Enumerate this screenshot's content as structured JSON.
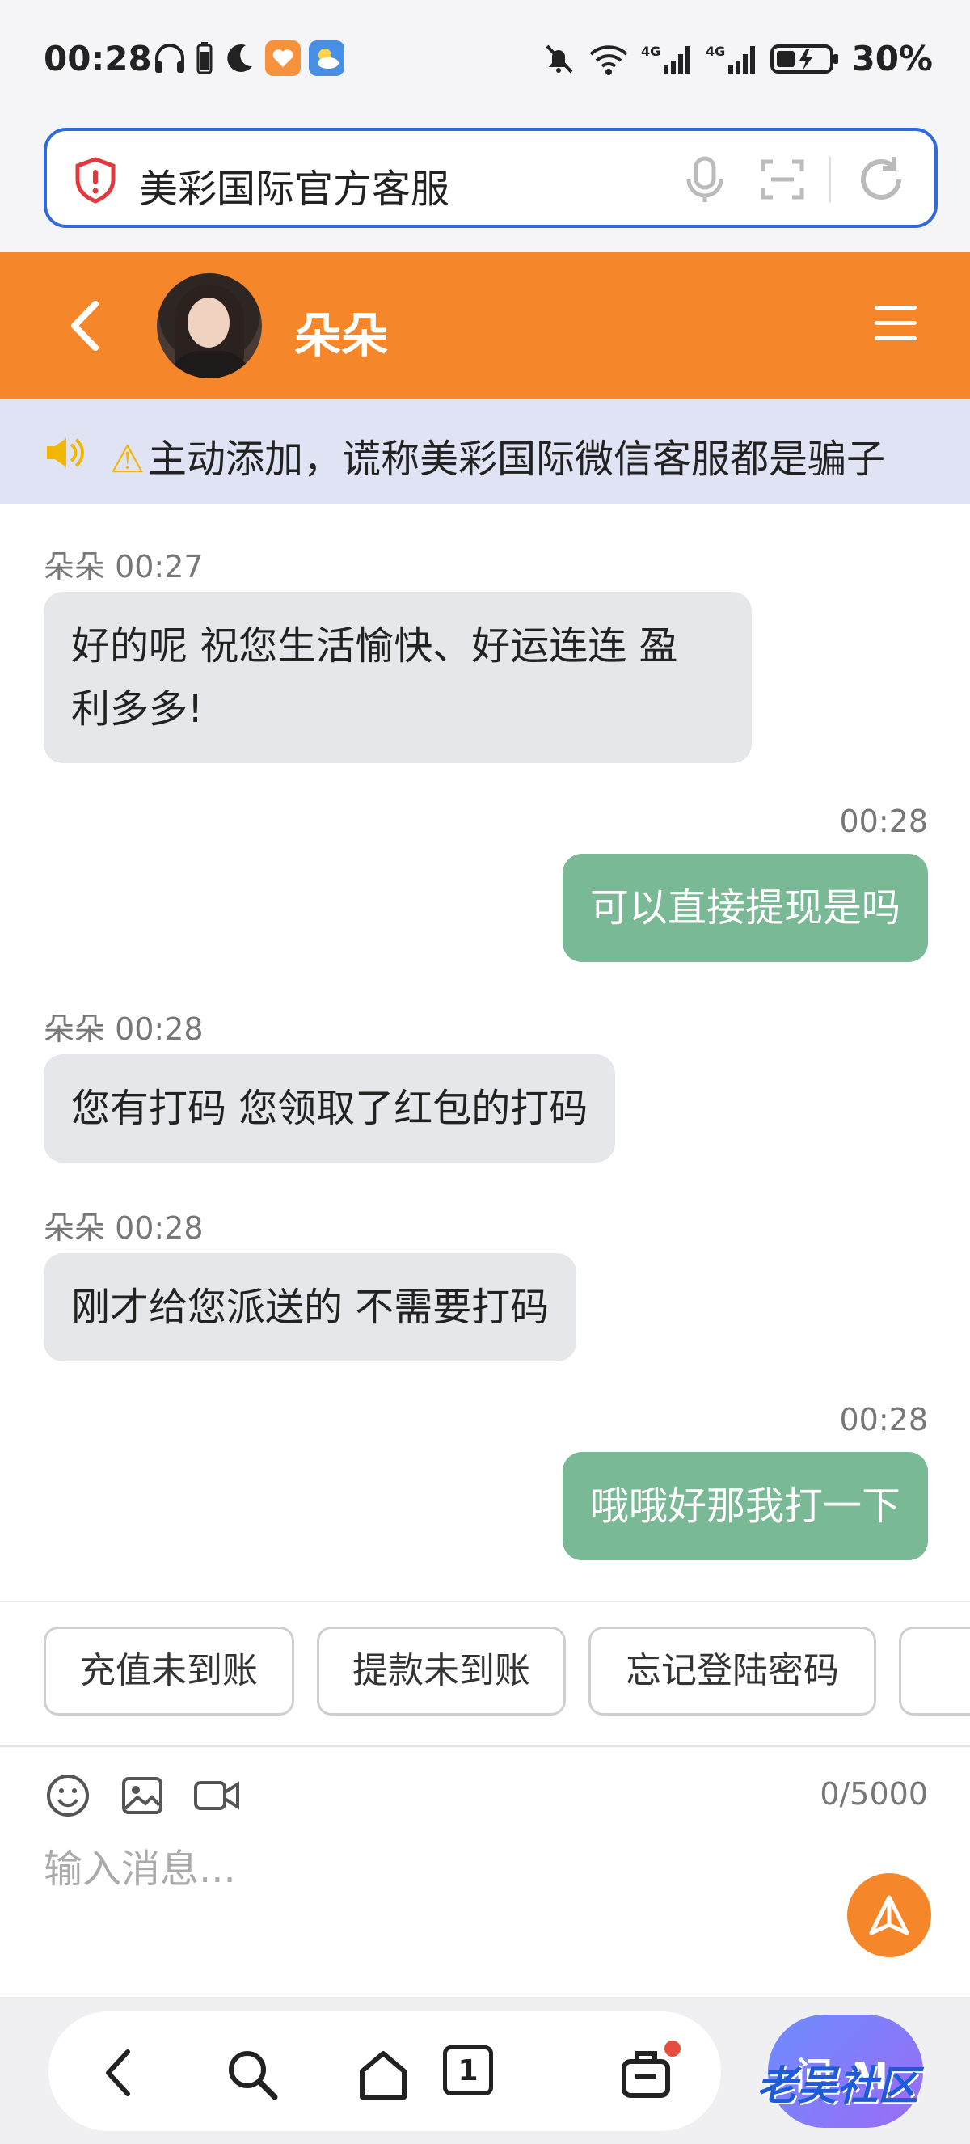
{
  "status_bar": {
    "time": "00:28",
    "battery": "30%",
    "network_1": "4G",
    "network_2": "4G"
  },
  "browser": {
    "url_text": "美彩国际官方客服"
  },
  "chat_header": {
    "contact_name": "朵朵"
  },
  "notice": {
    "text": "主动添加，谎称美彩国际微信客服都是骗子"
  },
  "messages": [
    {
      "direction": "in",
      "meta": "朵朵 00:27",
      "text_line1": "好的呢 祝您生活愉快、好运连连 盈",
      "text_line2": "利多多!"
    },
    {
      "direction": "out",
      "meta": "00:28",
      "text": "可以直接提现是吗"
    },
    {
      "direction": "in",
      "meta": "朵朵 00:28",
      "text": "您有打码 您领取了红包的打码"
    },
    {
      "direction": "in",
      "meta": "朵朵 00:28",
      "text": "刚才给您派送的 不需要打码"
    },
    {
      "direction": "out",
      "meta": "00:28",
      "text": "哦哦好那我打一下"
    }
  ],
  "quick_replies": [
    "充值未到账",
    "提款未到账",
    "忘记登陆密码"
  ],
  "input": {
    "placeholder": "输入消息...",
    "counter": "0/5000"
  },
  "bottom_nav": {
    "tab_count": "1",
    "ai_label": "问 AI"
  },
  "watermark": "老吴社区",
  "colors": {
    "header": "#f5862a",
    "outgoing_bubble": "#79b995",
    "incoming_bubble": "#e6e7ea",
    "notice_bg": "#dfe3f3"
  }
}
